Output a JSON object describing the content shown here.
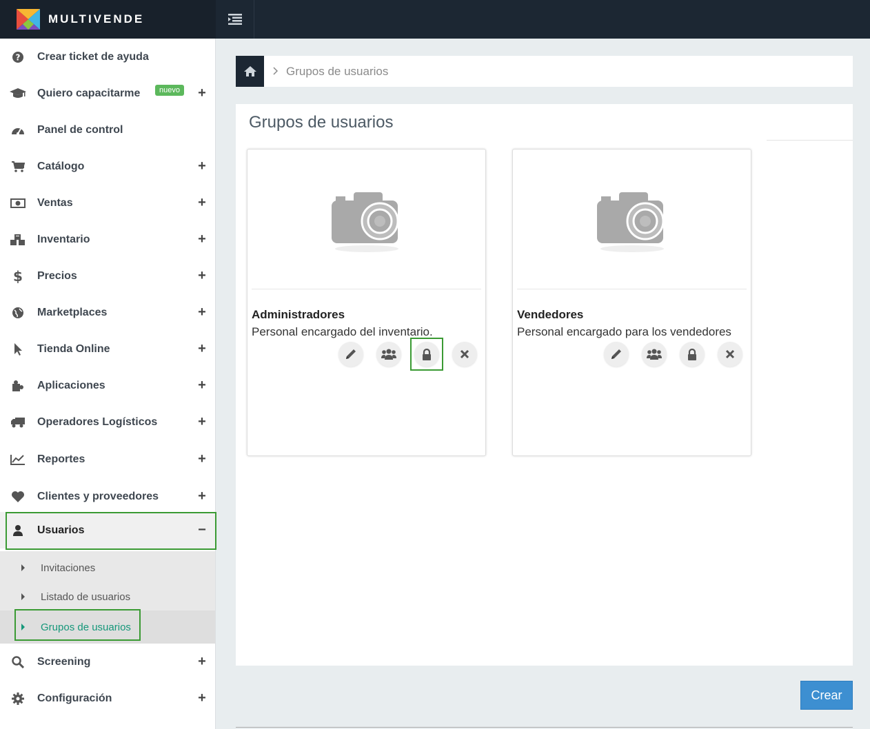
{
  "app": {
    "brand": "MULTIVENDE"
  },
  "sidebar": {
    "items": [
      {
        "label": "Crear ticket de ayuda",
        "icon": "question-circle-icon",
        "expand": ""
      },
      {
        "label": "Quiero capacitarme",
        "icon": "graduation-cap-icon",
        "expand": "+",
        "badge": "nuevo"
      },
      {
        "label": "Panel de control",
        "icon": "dashboard-icon",
        "expand": ""
      },
      {
        "label": "Catálogo",
        "icon": "cart-icon",
        "expand": "+"
      },
      {
        "label": "Ventas",
        "icon": "money-icon",
        "expand": "+"
      },
      {
        "label": "Inventario",
        "icon": "cubes-icon",
        "expand": "+"
      },
      {
        "label": "Precios",
        "icon": "dollar-icon",
        "expand": "+"
      },
      {
        "label": "Marketplaces",
        "icon": "globe-icon",
        "expand": "+"
      },
      {
        "label": "Tienda Online",
        "icon": "pointer-icon",
        "expand": "+"
      },
      {
        "label": "Aplicaciones",
        "icon": "puzzle-icon",
        "expand": "+"
      },
      {
        "label": "Operadores Logísticos",
        "icon": "truck-icon",
        "expand": "+"
      },
      {
        "label": "Reportes",
        "icon": "line-chart-icon",
        "expand": "+"
      },
      {
        "label": "Clientes y proveedores",
        "icon": "heart-icon",
        "expand": "+"
      },
      {
        "label": "Usuarios",
        "icon": "user-icon",
        "expand": "−"
      },
      {
        "label": "Screening",
        "icon": "search-icon",
        "expand": "+"
      },
      {
        "label": "Configuración",
        "icon": "gear-icon",
        "expand": "+"
      }
    ],
    "subitems": [
      {
        "label": "Invitaciones"
      },
      {
        "label": "Listado de usuarios"
      },
      {
        "label": "Grupos de usuarios"
      }
    ]
  },
  "breadcrumb": {
    "separator": ">",
    "current": "Grupos de usuarios"
  },
  "panel": {
    "title": "Grupos de usuarios"
  },
  "cards": [
    {
      "name": "Administradores",
      "description": "Personal encargado del inventario."
    },
    {
      "name": "Vendedores",
      "description": "Personal encargado para los vendedores"
    }
  ],
  "actions": {
    "create_label": "Crear"
  },
  "colors": {
    "topbar": "#1c2733",
    "accent_green": "#3a9a33",
    "active_text": "#15977a",
    "primary_button": "#3d8fd1",
    "badge": "#5cb85c"
  }
}
